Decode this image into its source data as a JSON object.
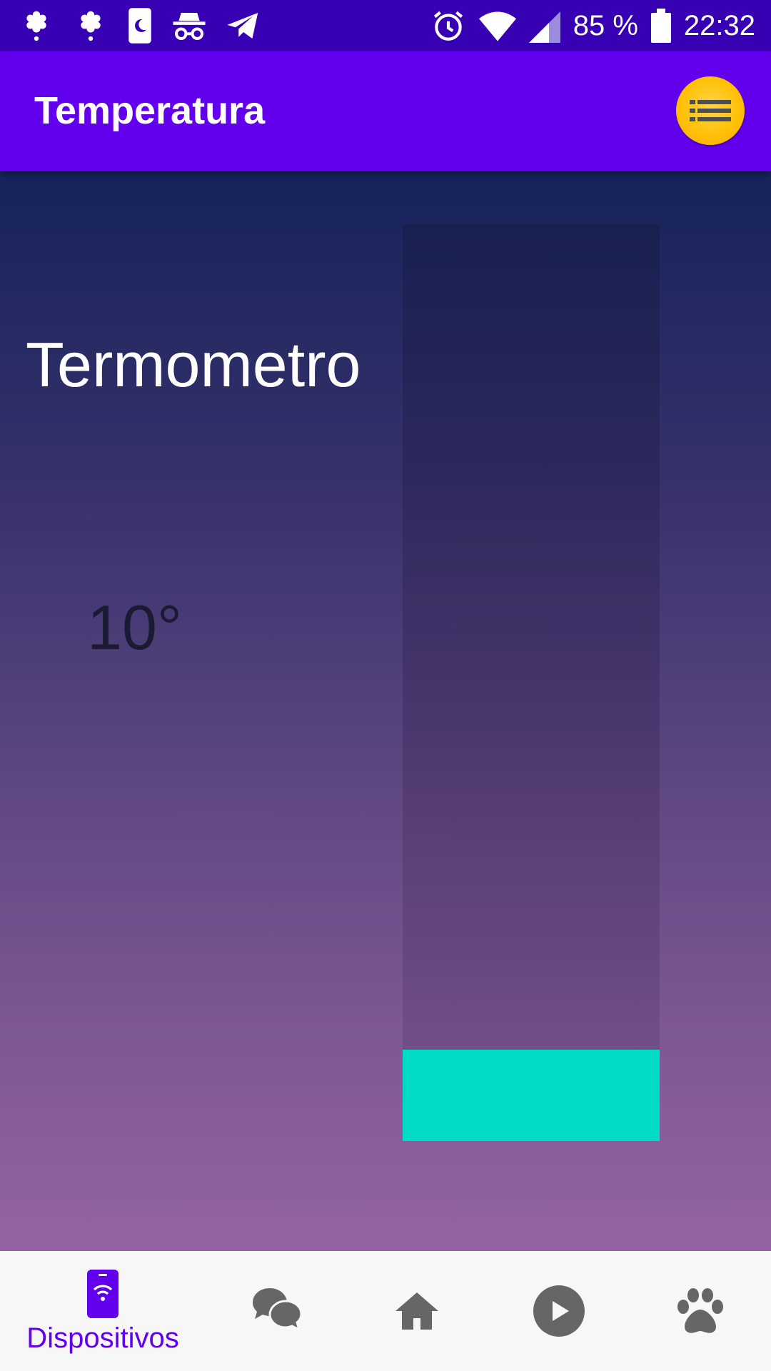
{
  "status_bar": {
    "battery": "85 %",
    "time": "22:32",
    "icons": [
      "flower-notification-icon",
      "flower-notification-icon",
      "phone-night-icon",
      "incognito-icon",
      "telegram-icon",
      "alarm-icon",
      "wifi-icon",
      "cell-signal-icon",
      "battery-icon"
    ]
  },
  "app_bar": {
    "title": "Temperatura",
    "menu_icon": "list-menu-icon"
  },
  "main": {
    "heading": "Termometro",
    "temperature": "10°",
    "thermometer_level": 0.1,
    "fill_color": "#00dbc4"
  },
  "bottom_nav": {
    "items": [
      {
        "icon": "smartphone-wifi-icon",
        "label": "Dispositivos",
        "selected": true
      },
      {
        "icon": "chat-bubbles-icon",
        "label": "",
        "selected": false
      },
      {
        "icon": "home-icon",
        "label": "",
        "selected": false
      },
      {
        "icon": "play-circle-icon",
        "label": "",
        "selected": false
      },
      {
        "icon": "paw-icon",
        "label": "",
        "selected": false
      }
    ],
    "accent": "#6200ee"
  },
  "colors": {
    "status_bar": "#3700b3",
    "app_bar": "#6200ee",
    "menu_button": "#ffc107"
  }
}
